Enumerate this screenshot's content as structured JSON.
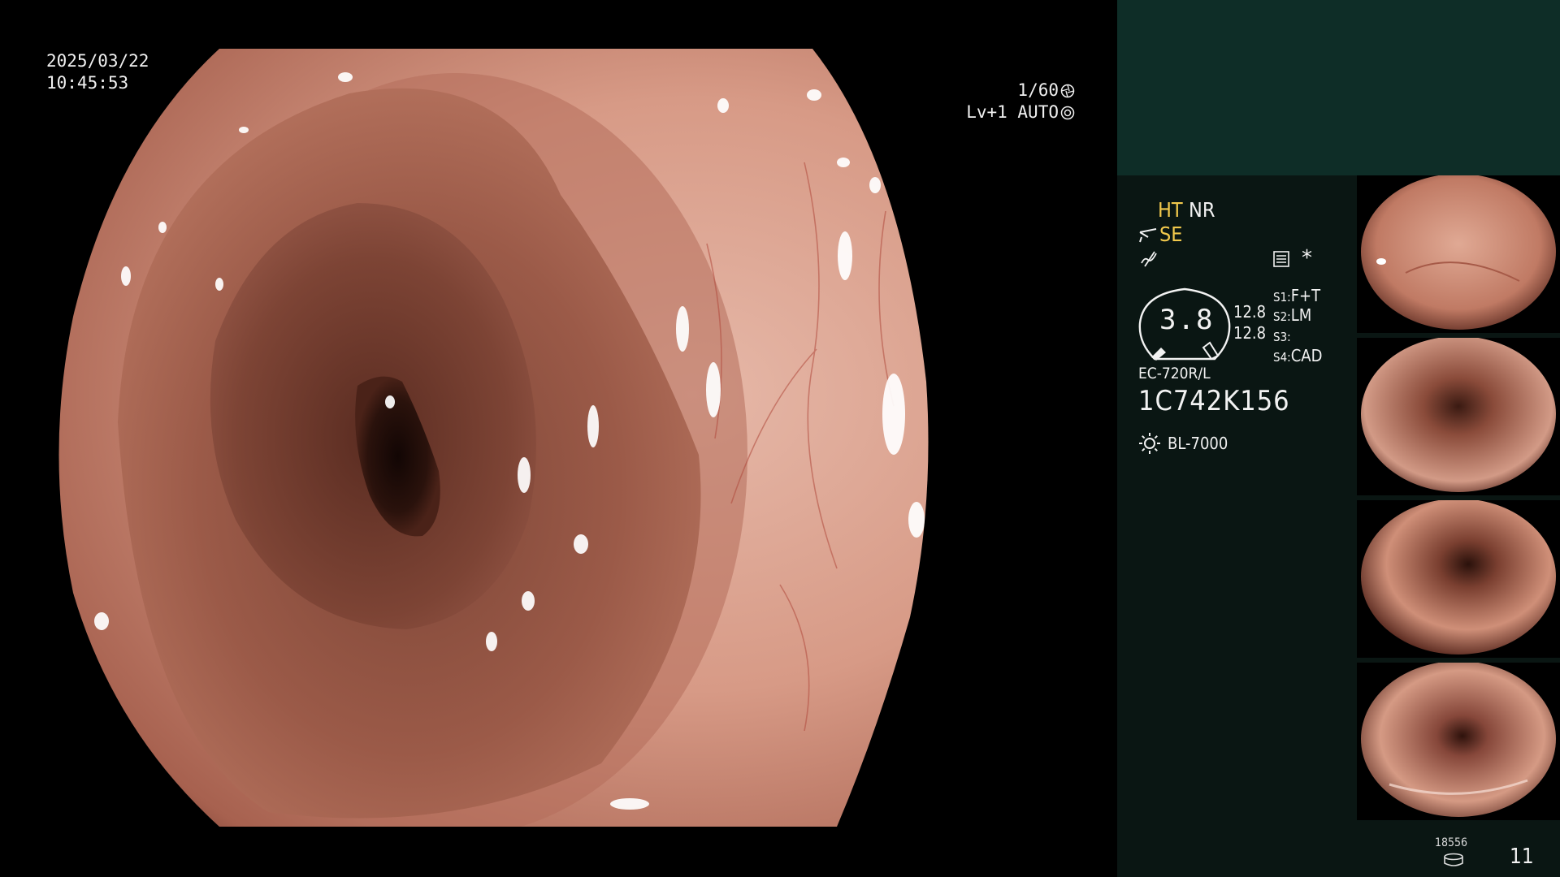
{
  "osd": {
    "date": "2025/03/22",
    "time": "10:45:53",
    "shutter": "1/60",
    "shutter_icon": "shutter-icon",
    "iris": "Lv+1 AUTO",
    "iris_icon": "iris-icon"
  },
  "status": {
    "ht": "HT",
    "nr": "NR",
    "se": "SE",
    "se_icon": "scissors-icon",
    "wave_icon": "wave-icon",
    "menu_icon": "menu-icon",
    "asterisk": "*",
    "gauge_value": "3.8",
    "value_1": "12.8",
    "value_2": "12.8",
    "switches": [
      {
        "key": "S1:",
        "value": "F+T"
      },
      {
        "key": "S2:",
        "value": "LM"
      },
      {
        "key": "S3:",
        "value": ""
      },
      {
        "key": "S4:",
        "value": "CAD"
      }
    ],
    "scope_model": "EC-720R/L",
    "scope_serial": "1C742K156",
    "light_icon": "sun-icon",
    "light_source": "BL-7000"
  },
  "footer": {
    "storage_icon": "storage-icon",
    "storage_count": "18556",
    "image_count": "11"
  },
  "colors": {
    "panel_top": "#0e2d27",
    "panel_bg": "#0a1613",
    "highlight": "#f2c94c",
    "tissue": "#c98a76"
  }
}
